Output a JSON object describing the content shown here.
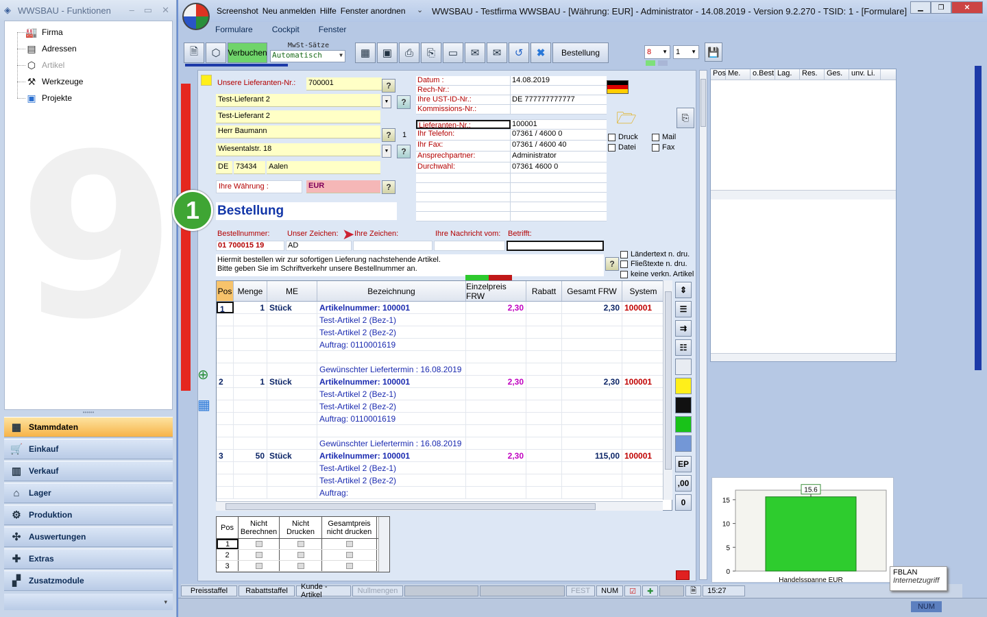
{
  "left_window": {
    "title": "WWSBAU - Funktionen",
    "tree": [
      {
        "label": "Firma",
        "icon": "factory-icon",
        "dim": false
      },
      {
        "label": "Adressen",
        "icon": "address-card-icon",
        "dim": false
      },
      {
        "label": "Artikel",
        "icon": "box-icon",
        "dim": true
      },
      {
        "label": "Werkzeuge",
        "icon": "tools-icon",
        "dim": false
      },
      {
        "label": "Projekte",
        "icon": "project-icon",
        "dim": false
      }
    ],
    "nav": [
      {
        "label": "Stammdaten",
        "icon": "database-icon",
        "active": true
      },
      {
        "label": "Einkauf",
        "icon": "cart-icon",
        "active": false
      },
      {
        "label": "Verkauf",
        "icon": "register-icon",
        "active": false
      },
      {
        "label": "Lager",
        "icon": "warehouse-icon",
        "active": false
      },
      {
        "label": "Produktion",
        "icon": "production-icon",
        "active": false
      },
      {
        "label": "Auswertungen",
        "icon": "chart-icon",
        "active": false
      },
      {
        "label": "Extras",
        "icon": "puzzle-icon",
        "active": false
      },
      {
        "label": "Zusatzmodule",
        "icon": "modules-icon",
        "active": false
      }
    ]
  },
  "main_window": {
    "menu": [
      "Screenshot",
      "Neu anmelden",
      "Hilfe",
      "Fenster anordnen"
    ],
    "caption": "WWSBAU - Testfirma WWSBAU - [Währung: EUR] - Administrator - 14.08.2019 - Version 9.2.270 - TSID: 1 - [Formulare]",
    "submenu": [
      "Formulare",
      "Cockpit",
      "Fenster"
    ],
    "toolbar": {
      "verbuchen": "Verbuchen",
      "mwst_label": "MwSt-Sätze",
      "mwst_value": "Automatisch",
      "bestellung_btn": "Bestellung",
      "sel1": "8",
      "sel2": "1"
    }
  },
  "form": {
    "lieferanten_nr_label": "Unsere Lieferanten-Nr.:",
    "lieferanten_nr": "700001",
    "name1": "Test-Lieferant 2",
    "name2": "Test-Lieferant 2",
    "contact": "Herr Baumann",
    "contact_index": "1",
    "street": "Wiesentalstr. 18",
    "country": "DE",
    "zip": "73434",
    "city": "Aalen",
    "currency_label": "Ihre Währung :",
    "currency": "EUR",
    "title": "Bestellung",
    "badge": "1",
    "right_fields": [
      {
        "label": "Datum :",
        "value": "14.08.2019"
      },
      {
        "label": "Rech-Nr.:",
        "value": ""
      },
      {
        "label": "Ihre UST-ID-Nr.:",
        "value": "DE 777777777777"
      },
      {
        "label": "Kommissions-Nr.:",
        "value": ""
      },
      {
        "label": "Lieferanten-Nr.:",
        "value": "100001"
      },
      {
        "label": "Ihr Telefon:",
        "value": "07361 / 4600 0"
      },
      {
        "label": "Ihr Fax:",
        "value": "07361 / 4600 40"
      },
      {
        "label": "Ansprechpartner:",
        "value": "Administrator"
      },
      {
        "label": "Durchwahl:",
        "value": "07361 4600 0"
      }
    ],
    "checks": {
      "druck": "Druck",
      "datei": "Datei",
      "mail": "Mail",
      "fax": "Fax"
    },
    "order_labels": [
      "Bestellnummer:",
      "Unser Zeichen:",
      "Ihre Zeichen:",
      "Ihre Nachricht vom:",
      "Betrifft:"
    ],
    "order_values": [
      "01 700015 19",
      "AD",
      "",
      "",
      ""
    ],
    "intro_line1": "Hiermit bestellen wir zur sofortigen Lieferung nachstehende Artikel.",
    "intro_line2": "Bitte geben Sie im Schriftverkehr unsere Bestellnummer an.",
    "options": [
      "Ländertext  n. dru.",
      "Fließtexte n. dru.",
      "keine verkn. Artikel"
    ]
  },
  "grid": {
    "columns": [
      "Pos",
      "Menge",
      "ME",
      "Bezeichnung",
      "Einzelpreis FRW",
      "Rabatt",
      "Gesamt FRW",
      "System"
    ],
    "rows": [
      {
        "pos": "1",
        "menge": "1",
        "me": "Stück",
        "bez": "Artikelnummer: 100001",
        "ep": "2,30",
        "rab": "",
        "ges": "2,30",
        "sys": "100001",
        "bold": true
      },
      {
        "pos": "",
        "menge": "",
        "me": "",
        "bez": "Test-Artikel 2  (Bez-1)",
        "ep": "",
        "rab": "",
        "ges": "",
        "sys": "",
        "bold": false
      },
      {
        "pos": "",
        "menge": "",
        "me": "",
        "bez": "Test-Artikel 2  (Bez-2)",
        "ep": "",
        "rab": "",
        "ges": "",
        "sys": "",
        "bold": false
      },
      {
        "pos": "",
        "menge": "",
        "me": "",
        "bez": "Auftrag: 0110001619",
        "ep": "",
        "rab": "",
        "ges": "",
        "sys": "",
        "bold": false
      },
      {
        "pos": "",
        "menge": "",
        "me": "",
        "bez": "",
        "ep": "",
        "rab": "",
        "ges": "",
        "sys": "",
        "bold": false
      },
      {
        "pos": "",
        "menge": "",
        "me": "",
        "bez": "Gewünschter Liefertermin : 16.08.2019",
        "ep": "",
        "rab": "",
        "ges": "",
        "sys": "",
        "bold": false
      },
      {
        "pos": "2",
        "menge": "1",
        "me": "Stück",
        "bez": "Artikelnummer: 100001",
        "ep": "2,30",
        "rab": "",
        "ges": "2,30",
        "sys": "100001",
        "bold": true
      },
      {
        "pos": "",
        "menge": "",
        "me": "",
        "bez": "Test-Artikel 2  (Bez-1)",
        "ep": "",
        "rab": "",
        "ges": "",
        "sys": "",
        "bold": false
      },
      {
        "pos": "",
        "menge": "",
        "me": "",
        "bez": "Test-Artikel 2  (Bez-2)",
        "ep": "",
        "rab": "",
        "ges": "",
        "sys": "",
        "bold": false
      },
      {
        "pos": "",
        "menge": "",
        "me": "",
        "bez": "Auftrag: 0110001619",
        "ep": "",
        "rab": "",
        "ges": "",
        "sys": "",
        "bold": false
      },
      {
        "pos": "",
        "menge": "",
        "me": "",
        "bez": "",
        "ep": "",
        "rab": "",
        "ges": "",
        "sys": "",
        "bold": false
      },
      {
        "pos": "",
        "menge": "",
        "me": "",
        "bez": "Gewünschter Liefertermin : 16.08.2019",
        "ep": "",
        "rab": "",
        "ges": "",
        "sys": "",
        "bold": false
      },
      {
        "pos": "3",
        "menge": "50",
        "me": "Stück",
        "bez": "Artikelnummer: 100001",
        "ep": "2,30",
        "rab": "",
        "ges": "115,00",
        "sys": "100001",
        "bold": true
      },
      {
        "pos": "",
        "menge": "",
        "me": "",
        "bez": "Test-Artikel 2  (Bez-1)",
        "ep": "",
        "rab": "",
        "ges": "",
        "sys": "",
        "bold": false
      },
      {
        "pos": "",
        "menge": "",
        "me": "",
        "bez": "Test-Artikel 2  (Bez-2)",
        "ep": "",
        "rab": "",
        "ges": "",
        "sys": "",
        "bold": false
      },
      {
        "pos": "",
        "menge": "",
        "me": "",
        "bez": "Auftrag:",
        "ep": "",
        "rab": "",
        "ges": "",
        "sys": "",
        "bold": false
      }
    ]
  },
  "side_buttons": {
    "ep": "EP",
    "dec": ",00",
    "zero": "0"
  },
  "pos_grid": {
    "columns": [
      "Pos",
      "Nicht Berechnen",
      "Nicht Drucken",
      "Gesamtpreis nicht drucken"
    ],
    "rows": [
      "1",
      "2",
      "3"
    ]
  },
  "right_panel": {
    "columns": [
      "Pos",
      "Me.",
      "o.Best",
      "Lag.",
      "Res.",
      "Ges.",
      "unv. Li."
    ]
  },
  "chart_data": {
    "type": "bar",
    "categories": [
      "Handelsspanne EUR"
    ],
    "values": [
      15.6
    ],
    "title": "",
    "xlabel": "",
    "ylabel": "",
    "ylim": [
      0,
      17
    ],
    "yticks": [
      "0",
      "5",
      "10",
      "15"
    ],
    "data_label": "15.6",
    "bar_color": "#2ecc2e"
  },
  "tooltip": {
    "line1": "FBLAN",
    "line2": "Internetzugriff"
  },
  "status_bar": {
    "items": [
      "Preisstaffel",
      "Rabattstaffel",
      "Kunde - Artikel",
      "Nullmengen"
    ],
    "fest": "FEST",
    "num": "NUM",
    "time": "15:27",
    "bottom_num": "NUM"
  }
}
